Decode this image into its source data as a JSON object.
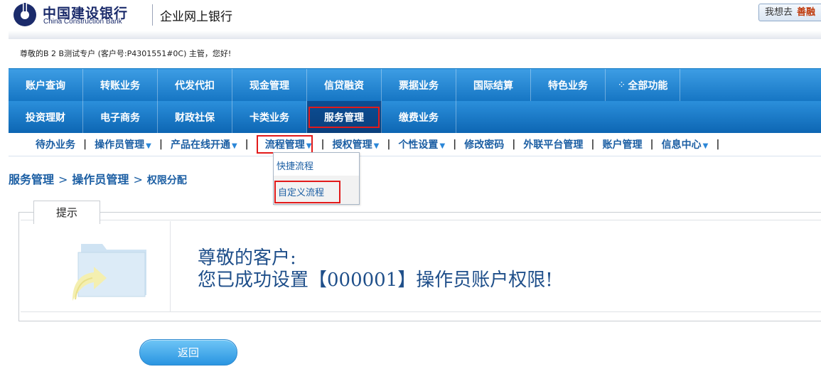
{
  "header": {
    "bank_name_cn": "中国建设银行",
    "bank_name_en": "China Construction Bank",
    "subtitle": "企业网上银行",
    "want_go_label": "我想去",
    "want_go_value": "善融"
  },
  "greeting": "尊敬的B 2 B测试专户 (客户号:P4301551#0C) 主管，您好!",
  "nav": {
    "row1": [
      "账户查询",
      "转账业务",
      "代发代扣",
      "现金管理",
      "信贷融资",
      "票据业务",
      "国际结算",
      "特色业务",
      "全部功能"
    ],
    "row2": [
      "投资理财",
      "电子商务",
      "财政社保",
      "卡类业务",
      "服务管理",
      "缴费业务"
    ],
    "active": "服务管理"
  },
  "subnav": {
    "items": [
      "待办业务",
      "操作员管理",
      "产品在线开通",
      "流程管理",
      "授权管理",
      "个性设置",
      "修改密码",
      "外联平台管理",
      "账户管理",
      "信息中心"
    ],
    "selected": "流程管理"
  },
  "dropdown": {
    "items": [
      "快捷流程",
      "自定义流程"
    ],
    "highlighted": "自定义流程"
  },
  "breadcrumb": {
    "level1": "服务管理",
    "level2": "操作员管理",
    "level3": "权限分配"
  },
  "notice": {
    "tab_label": "提示",
    "line1": "尊敬的客户:",
    "line2": "您已成功设置【000001】操作员账户权限!"
  },
  "back_button": "返回",
  "colors": {
    "nav_blue": "#1676c4",
    "nav_active": "#0a3f7c",
    "highlight_red": "#e21a1a",
    "link_blue": "#1b5ea3",
    "message_blue": "#1f4f8a"
  }
}
